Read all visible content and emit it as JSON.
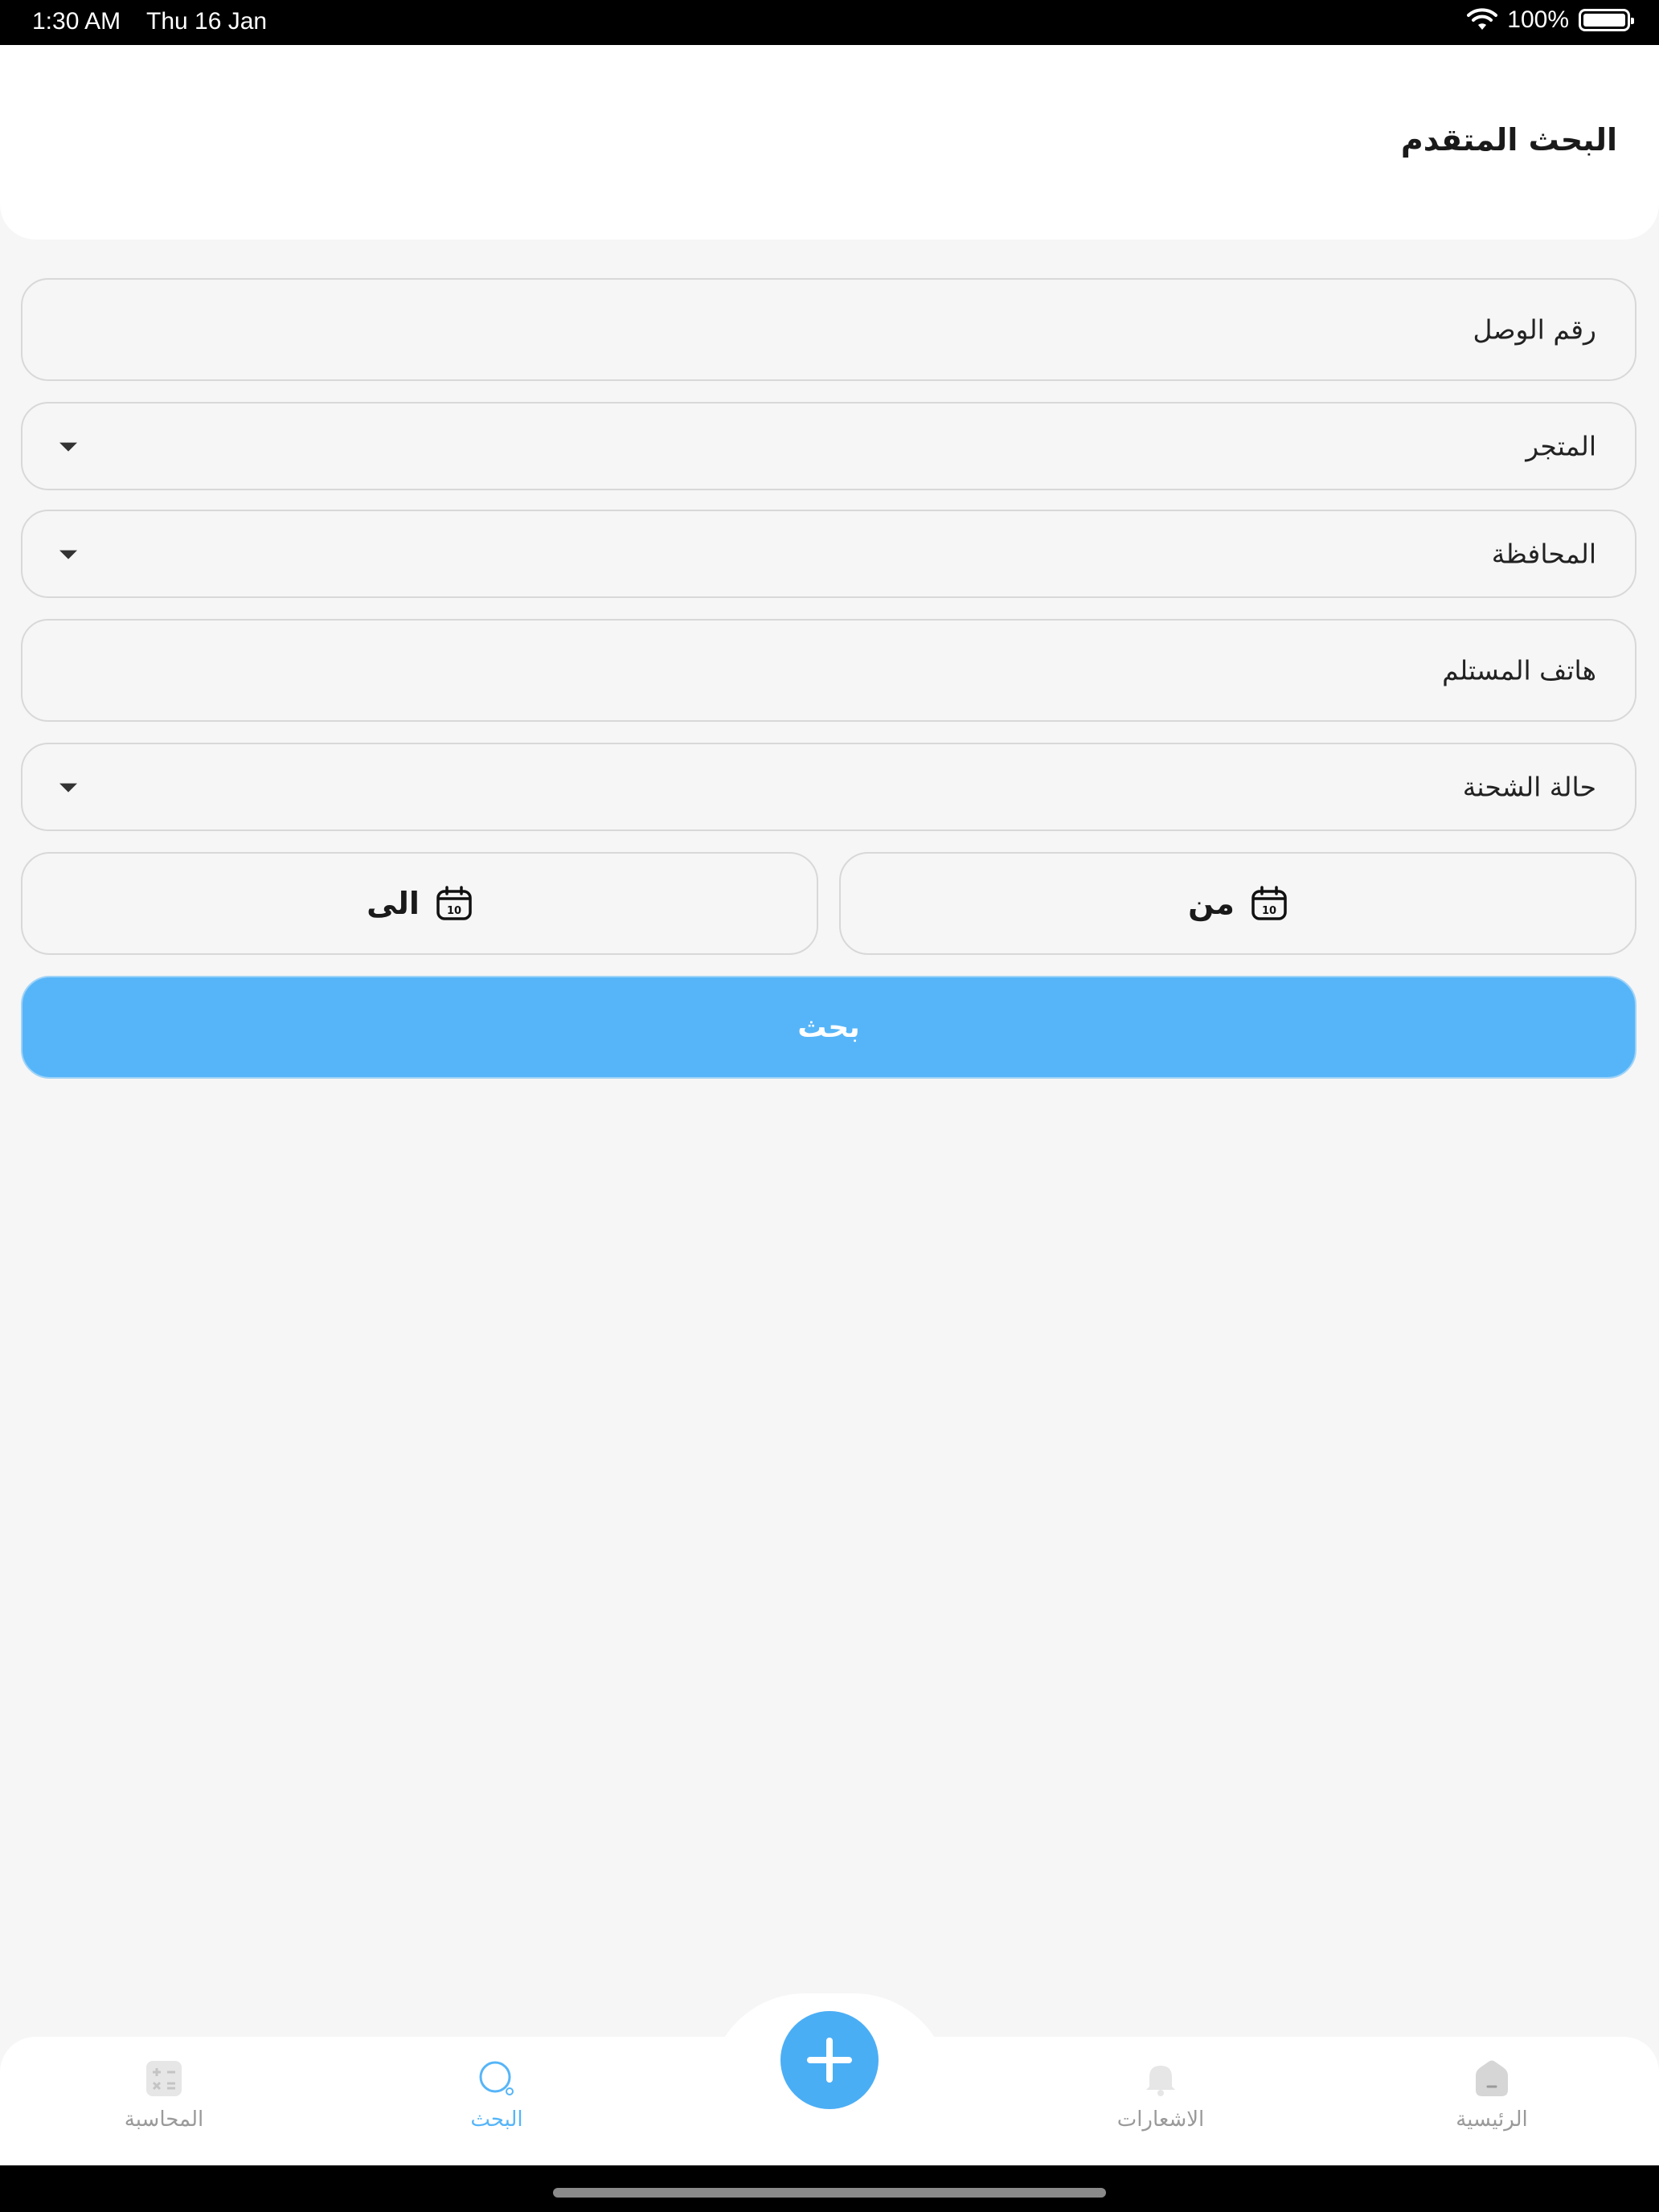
{
  "status_bar": {
    "time": "1:30 AM",
    "date": "Thu 16 Jan",
    "battery": "100%"
  },
  "header": {
    "title": "البحث المتقدم"
  },
  "form": {
    "receipt_number": "رقم الوصل",
    "store": "المتجر",
    "governorate": "المحافظة",
    "recipient_phone": "هاتف المستلم",
    "shipment_status": "حالة الشحنة",
    "date_from": "من",
    "date_to": "الى",
    "calendar_day": "10",
    "search_button": "بحث"
  },
  "bottom_nav": {
    "home": "الرئيسية",
    "notifications": "الاشعارات",
    "search": "البحث",
    "accounting": "المحاسبة"
  },
  "colors": {
    "accent": "#56b5f8",
    "background": "#f6f6f6"
  },
  "icons": {
    "wifi": "wifi-icon",
    "battery": "battery-icon",
    "calendar": "calendar-icon",
    "caret": "caret-down-icon",
    "add": "plus-icon",
    "home": "home-icon",
    "bell": "bell-icon",
    "search": "search-icon",
    "calculator": "calculator-icon"
  }
}
